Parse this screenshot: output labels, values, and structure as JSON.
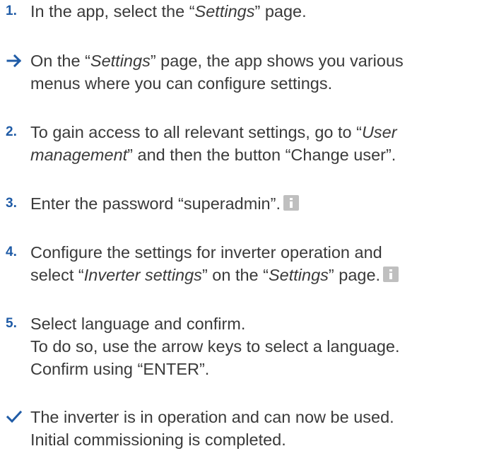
{
  "steps": [
    {
      "marker": "1.",
      "lines": [
        [
          "In the app, select the “",
          "Settings",
          "” page."
        ]
      ]
    },
    {
      "marker_icon": "arrow-right-icon",
      "lines": [
        [
          "On the “",
          "Settings",
          "” page, the app shows you various"
        ],
        [
          "menus where you can configure settings."
        ]
      ]
    },
    {
      "marker": "2.",
      "lines": [
        [
          "To gain access to all relevant settings, go to “",
          "User"
        ],
        [
          "management",
          "” and then the button “Change user”."
        ]
      ]
    },
    {
      "marker": "3.",
      "lines": [
        [
          "Enter the password “superadmin”."
        ]
      ],
      "info_icon": "info-icon"
    },
    {
      "marker": "4.",
      "lines": [
        [
          "Configure the settings for inverter operation and"
        ],
        [
          "select “",
          "Inverter settings",
          "” on the “",
          "Settings",
          "” page."
        ]
      ],
      "info_icon": "info-icon"
    },
    {
      "marker": "5.",
      "lines": [
        [
          "Select language and confirm."
        ],
        [
          "To do so, use the arrow keys to select a language."
        ],
        [
          "Confirm using “ENTER”."
        ]
      ]
    },
    {
      "marker_icon": "checkmark-icon",
      "lines": [
        [
          "The inverter is in operation and can now be used."
        ],
        [
          "Initial commissioning is completed."
        ]
      ]
    }
  ],
  "colors": {
    "accent": "#1f5ba6",
    "text": "#3a3a3a",
    "info_icon": "#bfbfbf"
  }
}
